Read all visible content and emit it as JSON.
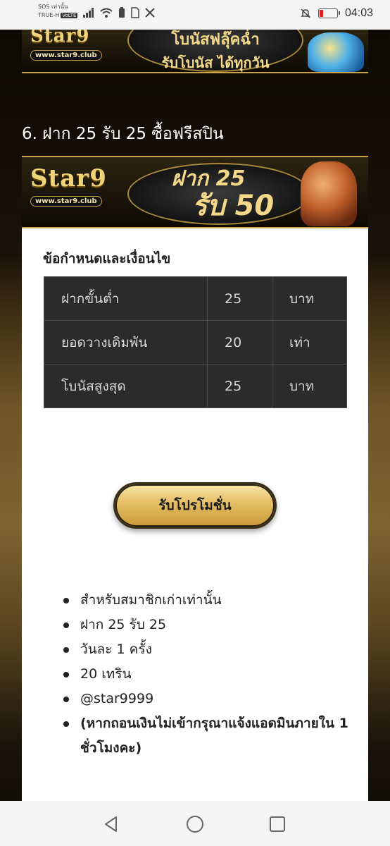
{
  "status_bar": {
    "carrier_line1": "SOS เท่านั้น",
    "carrier_line2": "TRUE-H",
    "volte": "VoLTE",
    "time": "04:03"
  },
  "banners": {
    "top": {
      "logo": "Star9",
      "url": "www.star9.club",
      "line1": "โบนัสฟลุ๊คฉ่ำ",
      "line2": "รับโบนัส ได้ทุกวัน"
    },
    "mid": {
      "logo": "Star9",
      "url": "www.star9.club",
      "line1": "ฝาก 25",
      "line2": "รับ 50"
    }
  },
  "section": {
    "title": "6. ฝาก 25 รับ 25 ซื้อฟรีสปิน"
  },
  "terms": {
    "title": "ข้อกำหนดและเงื่อนไข",
    "rows": [
      {
        "label": "ฝากขั้นต่ำ",
        "value": "25",
        "unit": "บาท"
      },
      {
        "label": "ยอดวางเดิมพัน",
        "value": "20",
        "unit": "เท่า"
      },
      {
        "label": "โบนัสสูงสุด",
        "value": "25",
        "unit": "บาท"
      }
    ]
  },
  "promo_button": {
    "label": "รับโปรโมชั่น"
  },
  "notes": [
    "สำหรับสมาชิกเก่าเท่านั้น",
    "ฝาก 25 รับ 25",
    "วันละ 1 ครั้ง",
    "20 เทริน",
    "@star9999",
    "(หากถอนเงินไม่เข้ากรุณาแจ้งแอดมินภายใน 1 ชั่วโมงคะ)"
  ],
  "icons": {
    "nav_back": "back-triangle-icon",
    "nav_home": "home-circle-icon",
    "nav_recent": "recent-square-icon"
  }
}
